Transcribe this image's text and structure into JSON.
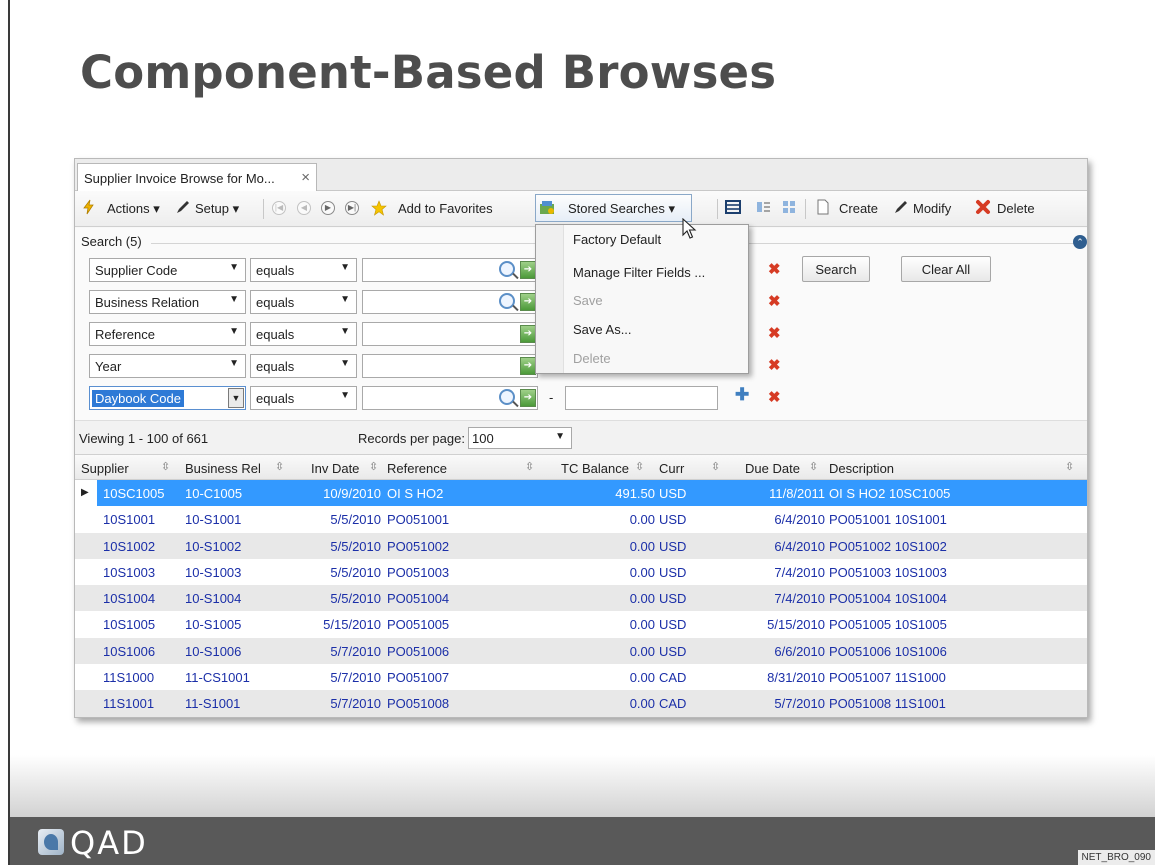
{
  "slide": {
    "title": "Component-Based Browses",
    "footer_logo": "QAD",
    "footer_code": "NET_BRO_090"
  },
  "window": {
    "tab_title": "Supplier Invoice Browse for Mo...",
    "tab_close": "×"
  },
  "toolbar": {
    "actions": "Actions ▾",
    "setup": "Setup ▾",
    "add_favorites": "Add to Favorites",
    "stored_searches": "Stored Searches ▾",
    "create": "Create",
    "modify": "Modify",
    "delete": "Delete"
  },
  "search": {
    "legend": "Search (5)",
    "rows": [
      {
        "field": "Supplier Code",
        "op": "equals"
      },
      {
        "field": "Business Relation",
        "op": "equals"
      },
      {
        "field": "Reference",
        "op": "equals"
      },
      {
        "field": "Year",
        "op": "equals"
      },
      {
        "field": "Daybook Code",
        "op": "equals"
      }
    ],
    "range_dash": "-",
    "search_button": "Search",
    "clear_button": "Clear All"
  },
  "stored_menu": {
    "items": [
      {
        "label": "Factory Default",
        "enabled": true
      },
      {
        "label": "Manage Filter Fields ...",
        "enabled": true
      },
      {
        "label": "Save",
        "enabled": false
      },
      {
        "label": "Save As...",
        "enabled": true
      },
      {
        "label": "Delete",
        "enabled": false
      }
    ]
  },
  "paging": {
    "viewing": "Viewing 1 - 100 of 661",
    "records_label": "Records per page:",
    "records_value": "100"
  },
  "grid": {
    "columns": [
      "Supplier",
      "Business Rel",
      "Inv Date",
      "Reference",
      "TC Balance",
      "Curr",
      "Due Date",
      "Description"
    ],
    "rows": [
      [
        "10SC1005",
        "10-C1005",
        "10/9/2010",
        "OI S HO2",
        "491.50",
        "USD",
        "11/8/2011",
        "OI S HO2 10SC1005"
      ],
      [
        "10S1001",
        "10-S1001",
        "5/5/2010",
        "PO051001",
        "0.00",
        "USD",
        "6/4/2010",
        "PO051001 10S1001"
      ],
      [
        "10S1002",
        "10-S1002",
        "5/5/2010",
        "PO051002",
        "0.00",
        "USD",
        "6/4/2010",
        "PO051002 10S1002"
      ],
      [
        "10S1003",
        "10-S1003",
        "5/5/2010",
        "PO051003",
        "0.00",
        "USD",
        "7/4/2010",
        "PO051003 10S1003"
      ],
      [
        "10S1004",
        "10-S1004",
        "5/5/2010",
        "PO051004",
        "0.00",
        "USD",
        "7/4/2010",
        "PO051004 10S1004"
      ],
      [
        "10S1005",
        "10-S1005",
        "5/15/2010",
        "PO051005",
        "0.00",
        "USD",
        "5/15/2010",
        "PO051005 10S1005"
      ],
      [
        "10S1006",
        "10-S1006",
        "5/7/2010",
        "PO051006",
        "0.00",
        "USD",
        "6/6/2010",
        "PO051006 10S1006"
      ],
      [
        "11S1000",
        "11-CS1001",
        "5/7/2010",
        "PO051007",
        "0.00",
        "CAD",
        "8/31/2010",
        "PO051007 11S1000"
      ],
      [
        "11S1001",
        "11-S1001",
        "5/7/2010",
        "PO051008",
        "0.00",
        "CAD",
        "5/7/2010",
        "PO051008 11S1001"
      ]
    ]
  },
  "colors": {
    "selected_row": "#3399ff",
    "link_text": "#1b2fa8",
    "remove_icon": "#d63b24",
    "footer": "#595959"
  }
}
